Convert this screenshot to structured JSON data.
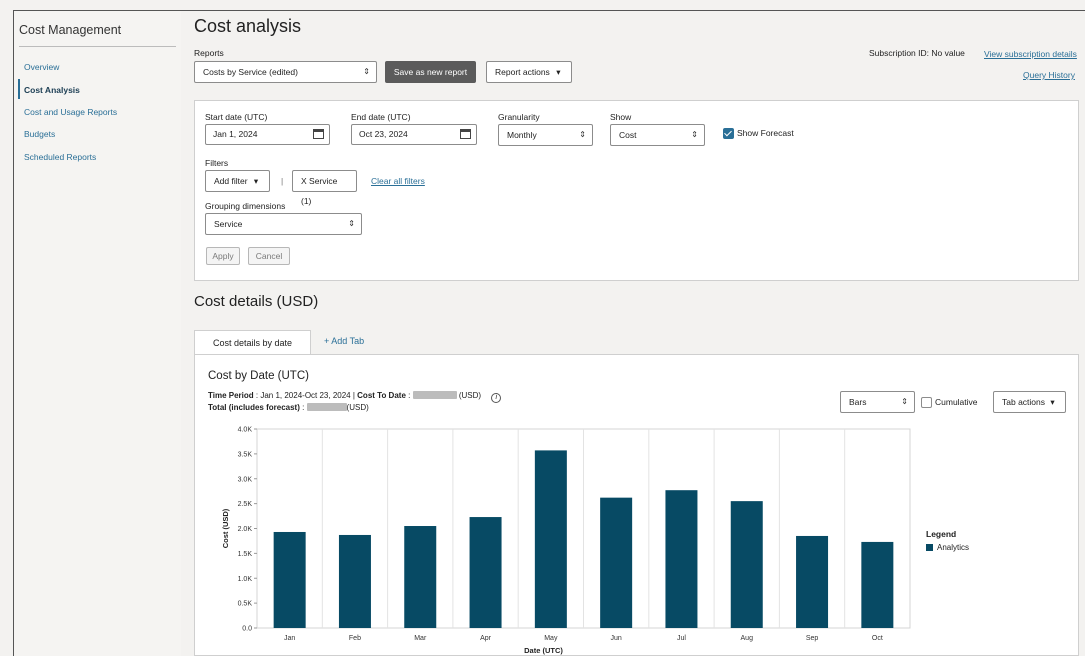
{
  "sidebar": {
    "title": "Cost Management",
    "items": [
      {
        "label": "Overview"
      },
      {
        "label": "Cost Analysis"
      },
      {
        "label": "Cost and Usage Reports"
      },
      {
        "label": "Budgets"
      },
      {
        "label": "Scheduled Reports"
      }
    ],
    "active_index": 1
  },
  "header": {
    "title": "Cost analysis",
    "reports_label": "Reports",
    "report_select_value": "Costs by Service (edited)",
    "save_button": "Save as new report",
    "report_actions": "Report actions",
    "subscription_id": "Subscription ID: No value",
    "view_subscription_link": "View subscription details",
    "query_history_link": "Query History"
  },
  "filters": {
    "start_date_label": "Start date (UTC)",
    "start_date_value": "Jan 1, 2024",
    "end_date_label": "End date (UTC)",
    "end_date_value": "Oct 23, 2024",
    "granularity_label": "Granularity",
    "granularity_value": "Monthly",
    "show_label": "Show",
    "show_value": "Cost",
    "show_forecast_label": "Show Forecast",
    "show_forecast_checked": true,
    "filters_label": "Filters",
    "add_filter": "Add filter",
    "separator": "|",
    "service_chip": "X Service (1)",
    "clear_filters": "Clear all filters",
    "grouping_label": "Grouping dimensions",
    "grouping_value": "Service",
    "apply": "Apply",
    "cancel": "Cancel"
  },
  "details": {
    "section_title": "Cost details (USD)",
    "tab_active": "Cost details by date",
    "tab_add": "+ Add Tab",
    "chart_title": "Cost by Date (UTC)",
    "time_period_label": "Time Period",
    "time_period_value": ": Jan 1, 2024-Oct 23, 2024 |",
    "cost_to_date_label": "Cost To Date",
    "cost_to_date_suffix": "(USD)",
    "total_label": "Total (includes forecast)",
    "total_suffix": "(USD)",
    "view_select": "Bars",
    "cumulative_label": "Cumulative",
    "cumulative_checked": false,
    "tab_actions": "Tab actions"
  },
  "icons": {
    "calendar": "calendar-icon",
    "chevron": "chevron-down-icon",
    "updown": "select-arrows-icon",
    "info": "info-icon"
  },
  "colors": {
    "bar": "#074a64",
    "link": "#2a6f97",
    "dark_button": "#5b5b5b"
  },
  "chart_data": {
    "type": "bar",
    "categories": [
      "Jan",
      "Feb",
      "Mar",
      "Apr",
      "May",
      "Jun",
      "Jul",
      "Aug",
      "Sep",
      "Oct"
    ],
    "series": [
      {
        "name": "Analytics",
        "values": [
          1930,
          1870,
          2050,
          2230,
          3570,
          2620,
          2770,
          2550,
          1850,
          1730
        ]
      }
    ],
    "xlabel": "Date (UTC)",
    "ylabel": "Cost (USD)",
    "ylim": [
      0,
      4000
    ],
    "yticks": [
      {
        "value": 0,
        "label": "0.0"
      },
      {
        "value": 500,
        "label": "0.5K"
      },
      {
        "value": 1000,
        "label": "1.0K"
      },
      {
        "value": 1500,
        "label": "1.5K"
      },
      {
        "value": 2000,
        "label": "2.0K"
      },
      {
        "value": 2500,
        "label": "2.5K"
      },
      {
        "value": 3000,
        "label": "3.0K"
      },
      {
        "value": 3500,
        "label": "3.5K"
      },
      {
        "value": 4000,
        "label": "4.0K"
      }
    ],
    "grid": "vertical",
    "legend_title": "Legend",
    "legend_position": "right"
  }
}
